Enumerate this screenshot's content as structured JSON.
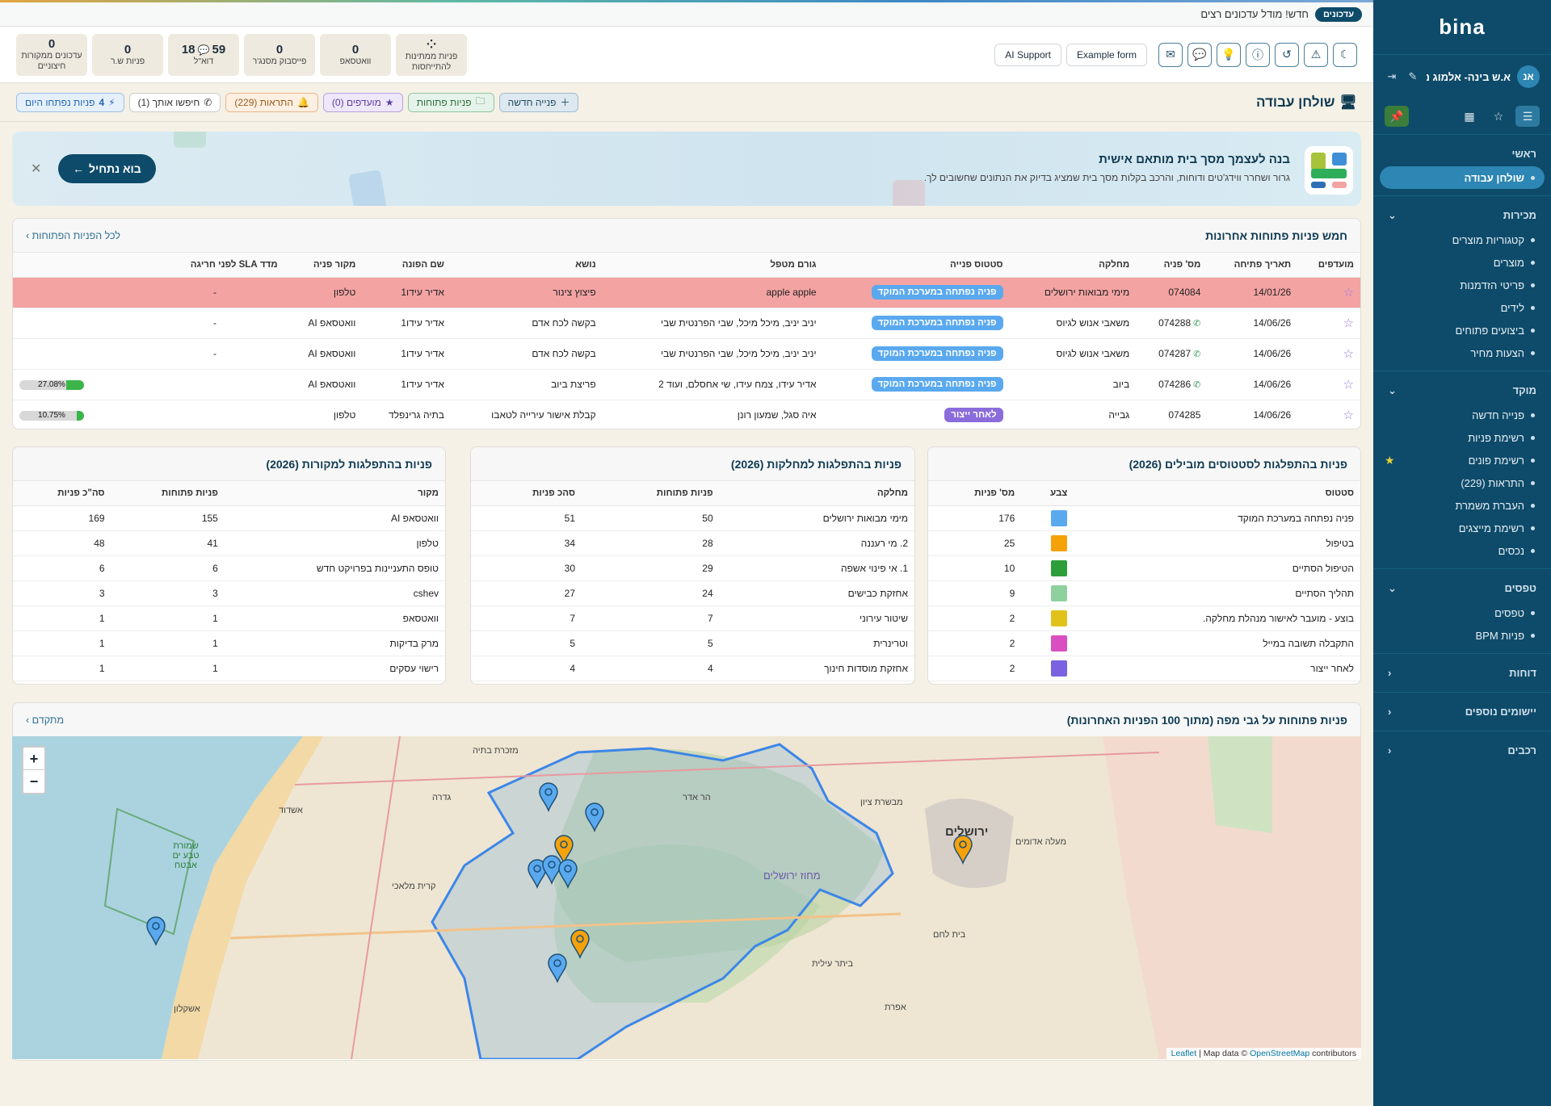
{
  "sidebar": {
    "logo": "bina",
    "user": {
      "initials": "אנ",
      "name": "א.ש בינה- אלמוג נ..."
    },
    "sections": [
      {
        "title": "ראשי",
        "items": [
          {
            "label": "שולחן עבודה",
            "active": true
          }
        ]
      },
      {
        "title": "מכירות",
        "items": [
          {
            "label": "קטגוריות מוצרים"
          },
          {
            "label": "מוצרים"
          },
          {
            "label": "פריטי הזדמנות"
          },
          {
            "label": "לידים"
          },
          {
            "label": "ביצועים פתוחים"
          },
          {
            "label": "הצעות מחיר"
          }
        ]
      },
      {
        "title": "מוקד",
        "items": [
          {
            "label": "פנייה חדשה"
          },
          {
            "label": "רשימת פניות"
          },
          {
            "label": "רשימת פונים",
            "starred": true
          },
          {
            "label": "התראות (229)"
          },
          {
            "label": "העברת משמרת"
          },
          {
            "label": "רשימת מייצגים"
          },
          {
            "label": "נכסים"
          }
        ]
      },
      {
        "title": "טפסים",
        "items": [
          {
            "label": "טפסים"
          },
          {
            "label": "פניות BPM"
          }
        ]
      },
      {
        "title": "דוחות",
        "items": []
      },
      {
        "title": "יישומים נוספים",
        "items": []
      },
      {
        "title": "רכבים",
        "items": []
      }
    ]
  },
  "notice": {
    "badge": "עדכונים",
    "text": "חדש! מודל עדכונים רצים"
  },
  "topbar": {
    "stats": [
      {
        "num": "",
        "label": "פניות ממתינות להתייחסות"
      },
      {
        "num": "0",
        "label": "וואטסאפ"
      },
      {
        "num": "0",
        "label": "פייסבוק מסנג'ר"
      },
      {
        "num": "59",
        "num2": "18",
        "label": "דוא\"ל"
      },
      {
        "num": "0",
        "label": "פניות ש.ר"
      },
      {
        "num": "0",
        "label": "עדכונים ממקורות חיצוניים"
      }
    ],
    "buttons": {
      "example_form": "Example form",
      "ai_support": "AI Support"
    }
  },
  "actions": {
    "page_title": "שולחן עבודה",
    "new_request": "פנייה חדשה",
    "open_requests": "פניות פתוחות",
    "favorites": "מועדפים (0)",
    "alerts": "התראות (229)",
    "searching": "חיפשו אותך (1)",
    "today_count": "4",
    "today_label": "פניות נפתחו היום"
  },
  "banner": {
    "title": "בנה לעצמך מסך בית מותאם אישית",
    "subtitle": "גרור ושחרר ווידג'טים ודוחות, והרכב בקלות מסך בית שמציג בדיוק את הנתונים שחשובים לך.",
    "cta": "בוא נתחיל"
  },
  "recent": {
    "title": "חמש פניות פתוחות אחרונות",
    "link": "לכל הפניות הפתוחות",
    "columns": [
      "מועדפים",
      "תאריך פתיחה",
      "מס' פניה",
      "מחלקה",
      "סטטוס פנייה",
      "גורם מטפל",
      "נושא",
      "שם הפונה",
      "מקור פניה",
      "מדד SLA לפני חריגה"
    ],
    "rows": [
      {
        "date": "14/01/26",
        "num": "074084",
        "wa": false,
        "dept": "מימי מבואות ירושלים",
        "status": "פניה נפתחה במערכת המוקד",
        "status_color": "blue",
        "handler": "apple apple",
        "subject": "פיצוץ צינור",
        "caller": "אדיר עידו1",
        "source": "טלפון",
        "sla": "-",
        "highlight": true
      },
      {
        "date": "14/06/26",
        "num": "074288",
        "wa": true,
        "dept": "משאבי אנוש לגיוס",
        "status": "פניה נפתחה במערכת המוקד",
        "status_color": "blue",
        "handler": "יניב יניב, מיכל מיכל, שבי הפרנטית שבי",
        "subject": "בקשה לכח אדם",
        "caller": "אדיר עידו1",
        "source": "וואטסאפ AI",
        "sla": "-"
      },
      {
        "date": "14/06/26",
        "num": "074287",
        "wa": true,
        "dept": "משאבי אנוש לגיוס",
        "status": "פניה נפתחה במערכת המוקד",
        "status_color": "blue",
        "handler": "יניב יניב, מיכל מיכל, שבי הפרנטית שבי",
        "subject": "בקשה לכח אדם",
        "caller": "אדיר עידו1",
        "source": "וואטסאפ AI",
        "sla": "-"
      },
      {
        "date": "14/06/26",
        "num": "074286",
        "wa": true,
        "dept": "ביוב",
        "status": "פניה נפתחה במערכת המוקד",
        "status_color": "blue",
        "handler": "אדיר עידו, צמח עידו, שי אחסלם, ועוד 2",
        "subject": "פריצת ביוב",
        "caller": "אדיר עידו1",
        "source": "וואטסאפ AI",
        "sla": "27.08%",
        "sla_value": 0.27
      },
      {
        "date": "14/06/26",
        "num": "074285",
        "wa": false,
        "dept": "גבייה",
        "status": "לאחר ייצור",
        "status_color": "purple",
        "handler": "איה סגל, שמעון רונן",
        "subject": "קבלת אישור עירייה לטאבו",
        "caller": "בתיה גרינפלד",
        "source": "טלפון",
        "sla": "10.75%",
        "sla_value": 0.11
      }
    ]
  },
  "by_status": {
    "title": "פניות בהתפלגות לסטטוסים מובילים (2026)",
    "columns": [
      "סטטוס",
      "צבע",
      "מס' פניות"
    ],
    "rows": [
      {
        "status": "פניה נפתחה במערכת המוקד",
        "color": "#5aa9ef",
        "count": "176"
      },
      {
        "status": "בטיפול",
        "color": "#f5a20a",
        "count": "25"
      },
      {
        "status": "הטיפול הסתיים",
        "color": "#2e9e3a",
        "count": "10"
      },
      {
        "status": "תהליך הסתיים",
        "color": "#8fd19e",
        "count": "9"
      },
      {
        "status": "בוצע - מועבר לאישור מנהלת מחלקה.",
        "color": "#e0c21a",
        "count": "2"
      },
      {
        "status": "התקבלה תשובה במייל",
        "color": "#d94fc2",
        "count": "2"
      },
      {
        "status": "לאחר ייצור",
        "color": "#7b62e0",
        "count": "2"
      }
    ]
  },
  "by_dept": {
    "title": "פניות בהתפלגות למחלקות (2026)",
    "columns": [
      "מחלקה",
      "פניות פתוחות",
      "סהכ פניות"
    ],
    "rows": [
      {
        "name": "מימי מבואות ירושלים",
        "open": "50",
        "total": "51"
      },
      {
        "name": "2. מי רעננה",
        "open": "28",
        "total": "34"
      },
      {
        "name": "1. אי פינוי אשפה",
        "open": "29",
        "total": "30"
      },
      {
        "name": "אחזקת כבישים",
        "open": "24",
        "total": "27"
      },
      {
        "name": "שיטור עירוני",
        "open": "7",
        "total": "7"
      },
      {
        "name": "וטרינרית",
        "open": "5",
        "total": "5"
      },
      {
        "name": "אחזקת מוסדות חינוך",
        "open": "4",
        "total": "4"
      }
    ]
  },
  "by_source": {
    "title": "פניות בהתפלגות למקורות (2026)",
    "columns": [
      "מקור",
      "פניות פתוחות",
      "סה\"כ פניות"
    ],
    "rows": [
      {
        "name": "וואטסאפ AI",
        "open": "155",
        "total": "169"
      },
      {
        "name": "טלפון",
        "open": "41",
        "total": "48"
      },
      {
        "name": "טופס התעניינות בפרויקט חדש",
        "open": "6",
        "total": "6"
      },
      {
        "name": "cshev",
        "open": "3",
        "total": "3"
      },
      {
        "name": "וואטסאפ",
        "open": "1",
        "total": "1"
      },
      {
        "name": "מרק בדיקות",
        "open": "1",
        "total": "1"
      },
      {
        "name": "רישוי עסקים",
        "open": "1",
        "total": "1"
      }
    ]
  },
  "map": {
    "title": "פניות פתוחות על גבי מפה (מתוך 100 הפניות האחרונות)",
    "link": "מתקדם",
    "zoom_in": "+",
    "zoom_out": "−",
    "attribution_leaflet": "Leaflet",
    "attribution_mid": " | Map data © ",
    "attribution_osm": "OpenStreetMap",
    "attribution_end": " contributors",
    "labels": [
      "ירושלים",
      "מעלה אדומים",
      "אשדוד",
      "אשקלון",
      "קרית מלאכי",
      "ביתר עילית",
      "מבשרת ציון",
      "שמורת טבע ים אבטח",
      "מזכרת בתיה",
      "גדרה",
      "הר אדר",
      "מחוז ירושלים",
      "בית לחם",
      "אפרת"
    ]
  }
}
